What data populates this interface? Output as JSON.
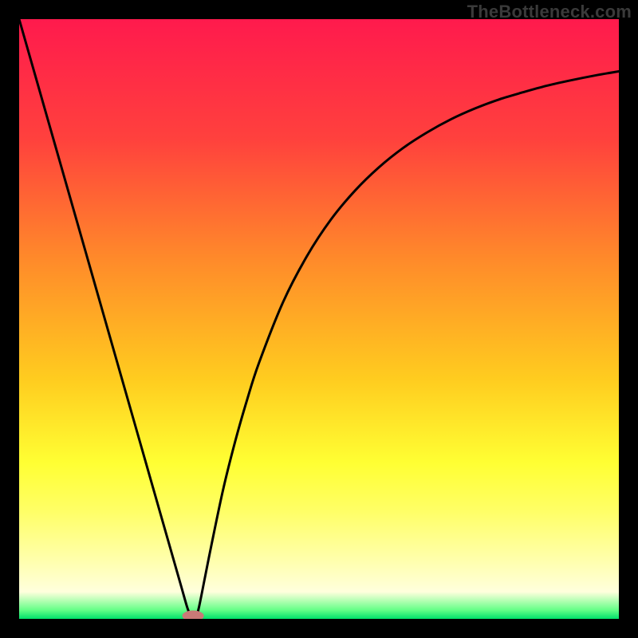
{
  "watermark": "TheBottleneck.com",
  "chart_data": {
    "type": "line",
    "title": "",
    "xlabel": "",
    "ylabel": "",
    "xlim": [
      0,
      100
    ],
    "ylim": [
      0,
      100
    ],
    "x_tick_labels": [],
    "y_tick_labels": [],
    "background_gradient": {
      "stops": [
        {
          "pos": 0.0,
          "color": "#ff1a4d"
        },
        {
          "pos": 0.2,
          "color": "#ff413d"
        },
        {
          "pos": 0.4,
          "color": "#ff8a2a"
        },
        {
          "pos": 0.6,
          "color": "#ffcc1f"
        },
        {
          "pos": 0.74,
          "color": "#ffff33"
        },
        {
          "pos": 0.82,
          "color": "#ffff66"
        },
        {
          "pos": 0.9,
          "color": "#ffffaa"
        },
        {
          "pos": 0.955,
          "color": "#ffffdd"
        },
        {
          "pos": 0.985,
          "color": "#66ff88"
        },
        {
          "pos": 1.0,
          "color": "#00e06a"
        }
      ]
    },
    "series": [
      {
        "name": "bottleneck-curve",
        "x": [
          0.0,
          2.0,
          4.0,
          6.0,
          8.0,
          10.0,
          12.0,
          14.0,
          16.0,
          18.0,
          20.0,
          22.0,
          24.0,
          26.0,
          27.0,
          28.0,
          28.5,
          29.0,
          29.5,
          30.0,
          31.0,
          32.0,
          34.0,
          36.0,
          38.0,
          40.0,
          44.0,
          48.0,
          52.0,
          56.0,
          60.0,
          64.0,
          68.0,
          72.0,
          76.0,
          80.0,
          84.0,
          88.0,
          92.0,
          96.0,
          100.0
        ],
        "y": [
          100.0,
          93.0,
          86.0,
          79.0,
          72.0,
          65.0,
          58.0,
          51.0,
          44.0,
          37.0,
          30.0,
          23.0,
          16.0,
          9.0,
          5.5,
          2.0,
          0.7,
          0.0,
          0.3,
          2.0,
          7.0,
          12.0,
          21.5,
          29.5,
          36.5,
          42.7,
          52.8,
          60.5,
          66.6,
          71.4,
          75.3,
          78.5,
          81.1,
          83.3,
          85.1,
          86.6,
          87.8,
          88.9,
          89.8,
          90.6,
          91.3
        ]
      }
    ],
    "marker": {
      "x": 29.0,
      "y": 0.5,
      "rx": 1.8,
      "ry": 0.9,
      "color": "#c97a77"
    },
    "notes": "Curve represents bottleneck percentage (y, 0=bottom/green, 100=top/red) vs. a normalized hardware-balance axis (x). Minimum ≈ x=29%."
  }
}
